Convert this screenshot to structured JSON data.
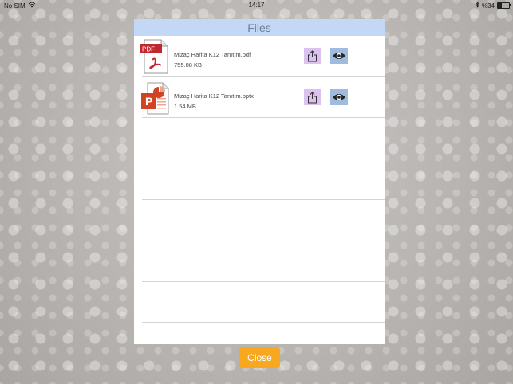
{
  "status_bar": {
    "carrier": "No SIM",
    "time": "14:17",
    "battery": "%34",
    "battery_level": 0.34
  },
  "modal": {
    "title": "Files",
    "files": [
      {
        "name": "Mizaç Harita K12 Tanıtım.pdf",
        "size": "755.08 KB",
        "type_icon": "pdf-file-icon",
        "icon_badge": "PDF"
      },
      {
        "name": "Mizaç Harita K12 Tanıtım.pptx",
        "size": "1.54 MB",
        "type_icon": "pptx-file-icon",
        "icon_badge": "P"
      }
    ],
    "share_icon": "share-icon",
    "view_icon": "eye-icon"
  },
  "close_label": "Close",
  "colors": {
    "header_bg": "#c2d8f4",
    "share_bg": "#dcc2ee",
    "view_bg": "#9fbcdf",
    "close_bg": "#f7a81f"
  }
}
